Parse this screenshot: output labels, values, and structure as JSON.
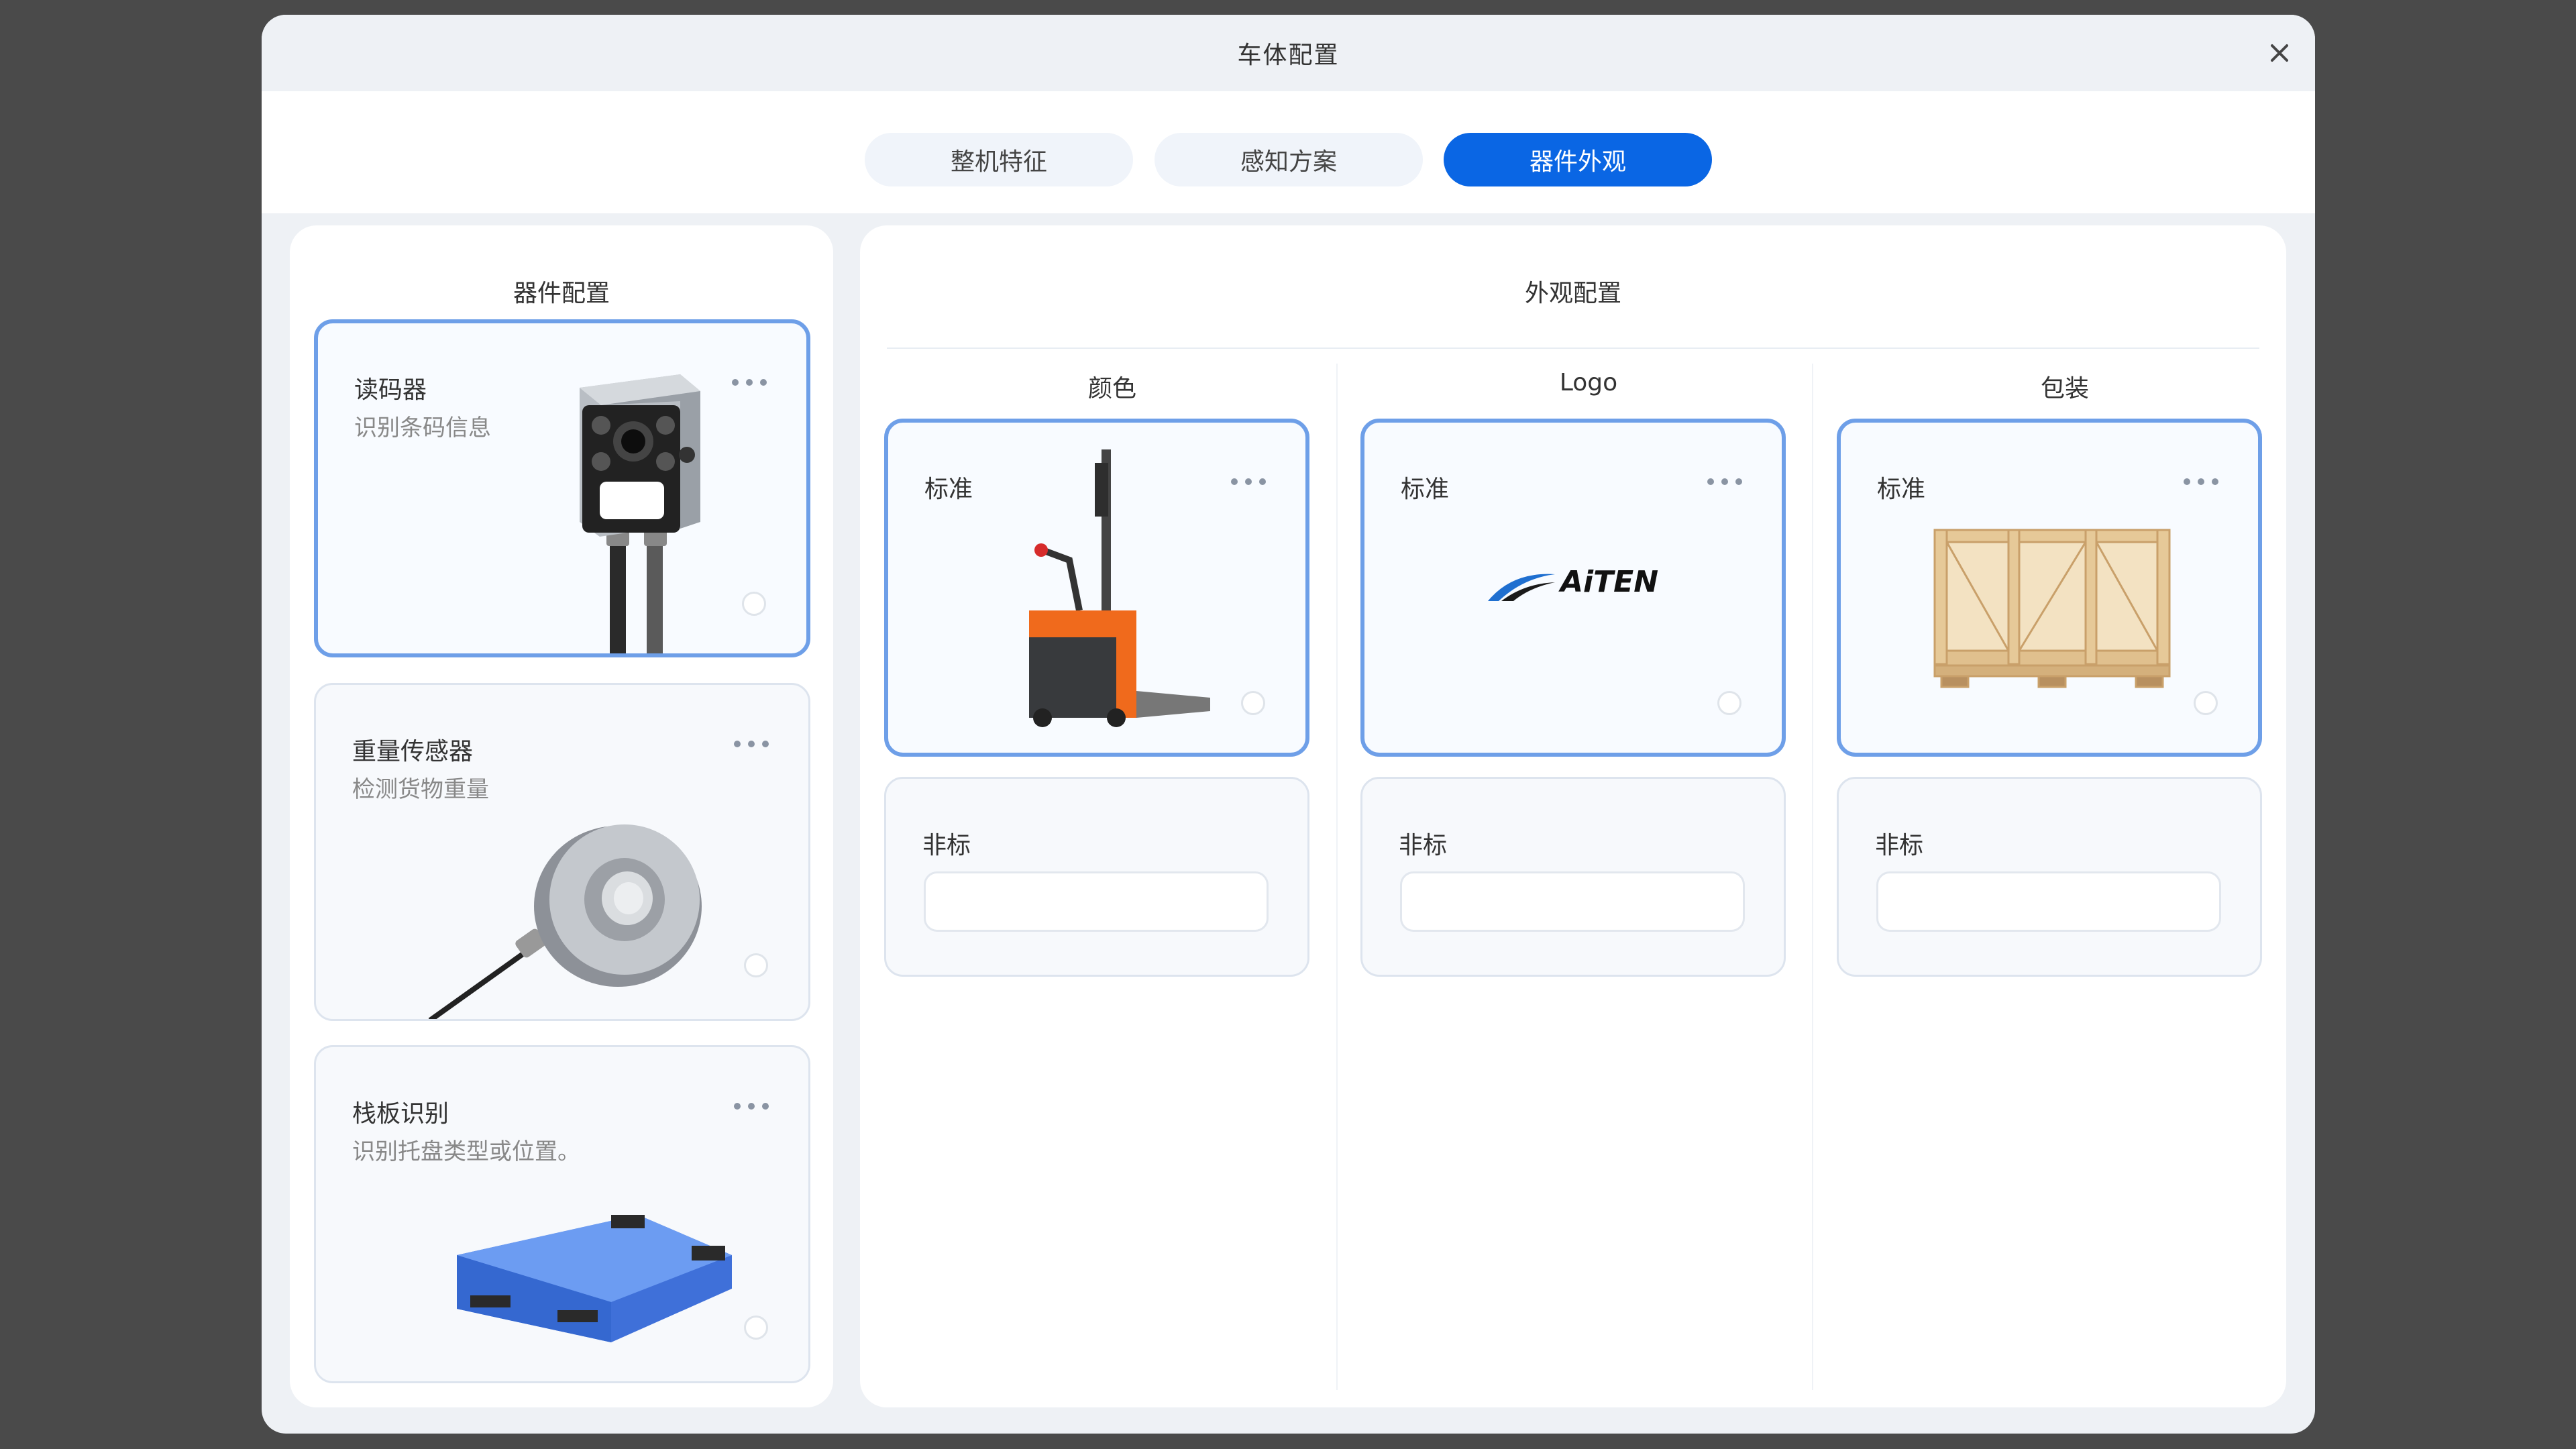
{
  "modal": {
    "title": "车体配置"
  },
  "tabs": [
    {
      "label": "整机特征",
      "active": false
    },
    {
      "label": "感知方案",
      "active": false
    },
    {
      "label": "器件外观",
      "active": true
    }
  ],
  "components": {
    "title": "器件配置",
    "items": [
      {
        "name": "读码器",
        "desc": "识别条码信息",
        "selected": true,
        "image": "barcode-reader"
      },
      {
        "name": "重量传感器",
        "desc": "检测货物重量",
        "selected": false,
        "image": "weight-sensor"
      },
      {
        "name": "栈板识别",
        "desc": "识别托盘类型或位置。",
        "selected": false,
        "image": "pallet"
      }
    ]
  },
  "appearance": {
    "title": "外观配置",
    "columns": [
      {
        "title": "颜色",
        "standard": {
          "label": "标准",
          "image": "forklift"
        },
        "custom": {
          "label": "非标",
          "value": ""
        }
      },
      {
        "title": "Logo",
        "standard": {
          "label": "标准",
          "image": "logo",
          "logo_text": "AiTEN"
        },
        "custom": {
          "label": "非标",
          "value": ""
        }
      },
      {
        "title": "包装",
        "standard": {
          "label": "标准",
          "image": "wooden-crate"
        },
        "custom": {
          "label": "非标",
          "value": ""
        }
      }
    ]
  },
  "colors": {
    "accent": "#0a66e4",
    "selected_border": "#6e9fe8",
    "overlay": "#4a4a4a",
    "logo_blue": "#1f6fd0"
  }
}
